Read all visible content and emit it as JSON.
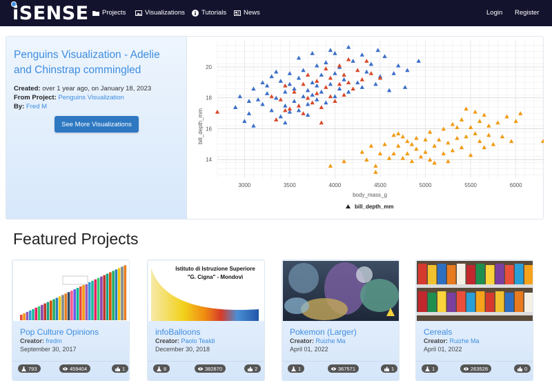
{
  "nav": {
    "logo": "iSENSE",
    "items": [
      {
        "label": "Projects",
        "icon": "folder-icon"
      },
      {
        "label": "Visualizations",
        "icon": "image-icon"
      },
      {
        "label": "Tutorials",
        "icon": "info-icon"
      },
      {
        "label": "News",
        "icon": "newspaper-icon"
      }
    ],
    "login": "Login",
    "register": "Register"
  },
  "hero": {
    "title": "Penguins Visualization - Adelie and Chinstrap commingled",
    "created_label": "Created:",
    "created_value": "over 1 year ago, on January 18, 2023",
    "project_label": "From Project:",
    "project_value": "Penguins Visualization",
    "by_label": "By:",
    "by_value": "Fred M",
    "button": "See More Visualizations"
  },
  "chart_data": {
    "type": "scatter",
    "xlabel": "body_mass_g",
    "ylabel": "bill_depth_mm",
    "legend": "bill_depth_mm",
    "legend_position": "bottom",
    "xlim": [
      2700,
      6300
    ],
    "ylim": [
      12.8,
      21.7
    ],
    "xticks": [
      3000,
      3500,
      4000,
      4500,
      5000,
      5500,
      6000
    ],
    "yticks": [
      14,
      16,
      18,
      20
    ],
    "grid": true,
    "colors": {
      "blue": "#3b6ec8",
      "red": "#d8492a",
      "orange": "#f09a12"
    },
    "series": [
      {
        "color_key": "blue",
        "points": [
          [
            2900,
            17.4
          ],
          [
            2950,
            18.1
          ],
          [
            3050,
            17.0
          ],
          [
            3100,
            18.6
          ],
          [
            3150,
            17.9
          ],
          [
            3200,
            19.0
          ],
          [
            3250,
            18.3
          ],
          [
            3300,
            19.4
          ],
          [
            3300,
            17.2
          ],
          [
            3350,
            18.0
          ],
          [
            3400,
            19.1
          ],
          [
            3400,
            16.8
          ],
          [
            3450,
            18.4
          ],
          [
            3450,
            17.5
          ],
          [
            3500,
            19.6
          ],
          [
            3500,
            18.9
          ],
          [
            3550,
            17.8
          ],
          [
            3550,
            18.6
          ],
          [
            3600,
            19.3
          ],
          [
            3600,
            17.2
          ],
          [
            3650,
            18.1
          ],
          [
            3650,
            19.8
          ],
          [
            3700,
            18.5
          ],
          [
            3700,
            17.6
          ],
          [
            3750,
            19.0
          ],
          [
            3750,
            18.2
          ],
          [
            3800,
            18.8
          ],
          [
            3800,
            17.9
          ],
          [
            3850,
            19.5
          ],
          [
            3850,
            18.4
          ],
          [
            3900,
            20.3
          ],
          [
            3900,
            17.7
          ],
          [
            3950,
            18.9
          ],
          [
            4000,
            19.6
          ],
          [
            4000,
            18.1
          ],
          [
            4050,
            20.0
          ],
          [
            4050,
            18.6
          ],
          [
            4100,
            19.2
          ],
          [
            4150,
            18.4
          ],
          [
            4200,
            20.4
          ],
          [
            4250,
            19.0
          ],
          [
            4300,
            18.7
          ],
          [
            4350,
            19.7
          ],
          [
            4400,
            20.2
          ],
          [
            4450,
            18.9
          ],
          [
            4475,
            21.1
          ],
          [
            4500,
            19.4
          ],
          [
            4550,
            20.7
          ],
          [
            4600,
            18.5
          ],
          [
            4650,
            19.6
          ],
          [
            4700,
            20.1
          ],
          [
            4775,
            18.7
          ],
          [
            4800,
            19.8
          ],
          [
            4925,
            20.4
          ],
          [
            3200,
            17.6
          ],
          [
            3350,
            19.7
          ],
          [
            3450,
            16.4
          ],
          [
            3500,
            17.1
          ],
          [
            3700,
            16.9
          ],
          [
            3100,
            16.2
          ],
          [
            3000,
            16.5
          ],
          [
            3600,
            20.6
          ],
          [
            3750,
            20.9
          ],
          [
            4150,
            21.3
          ],
          [
            3950,
            21.1
          ],
          [
            4000,
            20.9
          ],
          [
            3250,
            18.8
          ],
          [
            3800,
            20.1
          ],
          [
            4300,
            20.8
          ],
          [
            3050,
            17.8
          ]
        ]
      },
      {
        "color_key": "red",
        "points": [
          [
            2700,
            17.1
          ],
          [
            3300,
            18.1
          ],
          [
            3350,
            16.6
          ],
          [
            3400,
            17.9
          ],
          [
            3450,
            18.8
          ],
          [
            3500,
            17.3
          ],
          [
            3550,
            18.4
          ],
          [
            3600,
            17.5
          ],
          [
            3650,
            18.9
          ],
          [
            3700,
            18.0
          ],
          [
            3700,
            19.5
          ],
          [
            3750,
            17.7
          ],
          [
            3800,
            18.3
          ],
          [
            3800,
            19.1
          ],
          [
            3850,
            17.4
          ],
          [
            3900,
            18.7
          ],
          [
            3900,
            19.9
          ],
          [
            3950,
            18.1
          ],
          [
            3950,
            19.3
          ],
          [
            4000,
            17.8
          ],
          [
            4050,
            18.9
          ],
          [
            4100,
            19.5
          ],
          [
            4100,
            18.2
          ],
          [
            4150,
            19.0
          ],
          [
            4200,
            18.6
          ],
          [
            4250,
            19.8
          ],
          [
            4300,
            19.2
          ],
          [
            4350,
            20.4
          ],
          [
            4400,
            19.6
          ],
          [
            4500,
            19.3
          ],
          [
            3650,
            17.0
          ],
          [
            3850,
            16.4
          ],
          [
            3450,
            17.2
          ],
          [
            4050,
            20.1
          ],
          [
            4150,
            20.5
          ]
        ]
      },
      {
        "color_key": "orange",
        "points": [
          [
            3950,
            13.6
          ],
          [
            4100,
            13.9
          ],
          [
            4300,
            14.5
          ],
          [
            4350,
            14.0
          ],
          [
            4400,
            14.9
          ],
          [
            4450,
            13.6
          ],
          [
            4500,
            14.4
          ],
          [
            4550,
            15.0
          ],
          [
            4600,
            14.1
          ],
          [
            4650,
            15.6
          ],
          [
            4650,
            14.4
          ],
          [
            4700,
            14.9
          ],
          [
            4700,
            15.7
          ],
          [
            4750,
            14.1
          ],
          [
            4800,
            15.2
          ],
          [
            4800,
            14.4
          ],
          [
            4850,
            15.0
          ],
          [
            4850,
            13.9
          ],
          [
            4900,
            14.7
          ],
          [
            4900,
            15.4
          ],
          [
            4950,
            14.2
          ],
          [
            5000,
            15.3
          ],
          [
            5000,
            14.5
          ],
          [
            5050,
            15.8
          ],
          [
            5100,
            14.9
          ],
          [
            5100,
            13.8
          ],
          [
            5150,
            15.3
          ],
          [
            5200,
            14.4
          ],
          [
            5200,
            16.0
          ],
          [
            5250,
            15.1
          ],
          [
            5300,
            14.6
          ],
          [
            5300,
            16.3
          ],
          [
            5350,
            15.4
          ],
          [
            5400,
            14.8
          ],
          [
            5400,
            16.6
          ],
          [
            5450,
            15.5
          ],
          [
            5500,
            14.3
          ],
          [
            5500,
            16.1
          ],
          [
            5550,
            15.7
          ],
          [
            5550,
            17.1
          ],
          [
            5600,
            15.2
          ],
          [
            5600,
            16.5
          ],
          [
            5650,
            14.8
          ],
          [
            5650,
            16.9
          ],
          [
            5700,
            15.6
          ],
          [
            5700,
            16.2
          ],
          [
            5750,
            15.0
          ],
          [
            5800,
            16.4
          ],
          [
            5850,
            15.5
          ],
          [
            5900,
            16.8
          ],
          [
            5950,
            15.2
          ],
          [
            6000,
            16.5
          ],
          [
            6050,
            17.0
          ],
          [
            6300,
            15.2
          ],
          [
            5450,
            17.3
          ],
          [
            5350,
            16.1
          ],
          [
            4450,
            13.2
          ],
          [
            5050,
            14.0
          ],
          [
            4750,
            15.5
          ],
          [
            5250,
            13.9
          ]
        ]
      }
    ]
  },
  "featured": {
    "title": "Featured Projects",
    "creator_label": "Creator:",
    "cards": [
      {
        "title": "Pop Culture Opinions",
        "creator": "fredm",
        "date": "September 30, 2017",
        "users": "793",
        "views": "459404",
        "likes": "1"
      },
      {
        "title": "infoBalloons",
        "creator": "Paolo Tealdi",
        "date": "December 30, 2018",
        "users": "8",
        "views": "382870",
        "likes": "2",
        "thumb_line1": "Istituto di Istruzione Superiore",
        "thumb_line2": "\"G. Cigna\" - Mondovì"
      },
      {
        "title": "Pokemon (Larger)",
        "creator": "Ruizhe Ma",
        "date": "April 01, 2022",
        "users": "1",
        "views": "367571",
        "likes": "1"
      },
      {
        "title": "Cereals",
        "creator": "Ruizhe Ma",
        "date": "April 01, 2022",
        "users": "1",
        "views": "263528",
        "likes": "0"
      }
    ]
  }
}
